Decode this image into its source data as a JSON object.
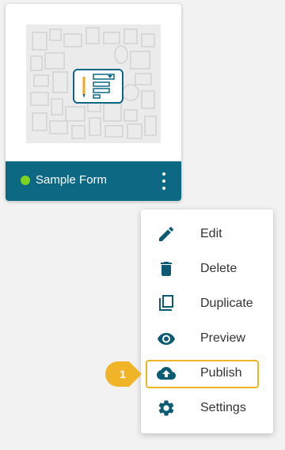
{
  "card": {
    "title": "Sample Form",
    "status_color": "#7ed321",
    "footer_color": "#0d6883"
  },
  "menu": {
    "items": [
      {
        "label": "Edit",
        "icon": "pencil-icon"
      },
      {
        "label": "Delete",
        "icon": "trash-icon"
      },
      {
        "label": "Duplicate",
        "icon": "copy-icon"
      },
      {
        "label": "Preview",
        "icon": "eye-icon"
      },
      {
        "label": "Publish",
        "icon": "cloud-upload-icon"
      },
      {
        "label": "Settings",
        "icon": "gear-icon"
      }
    ],
    "icon_color": "#0d5a73"
  },
  "callout": {
    "step": "1",
    "color": "#f0b429"
  }
}
